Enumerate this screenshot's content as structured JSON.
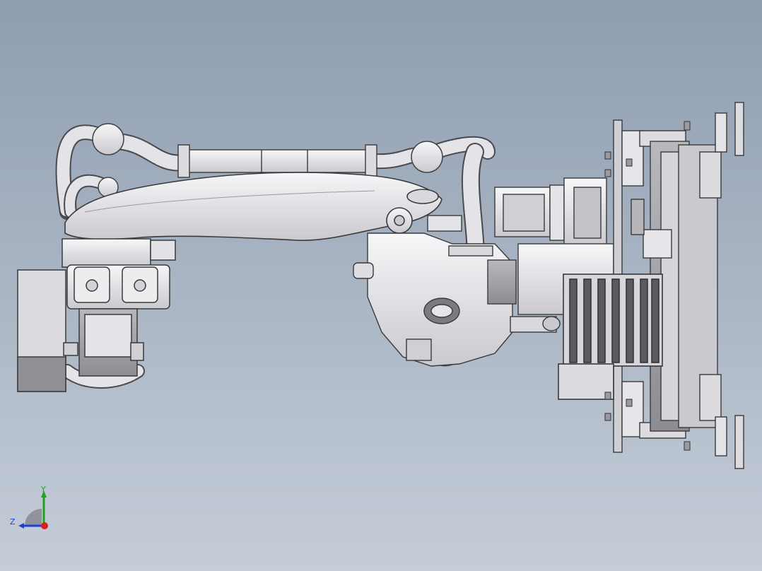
{
  "viewport": {
    "background_top": "#8e9db0",
    "background_bottom": "#c5cdd8"
  },
  "model": {
    "icon": "robot-arm-assembly",
    "body_color": "#e9e9ec",
    "edge_color": "#3a3a3a",
    "shade_color": "#b9b9bf"
  },
  "triad": {
    "y_label": "Y",
    "z_label": "Z",
    "y_color": "#1fa31f",
    "z_color": "#1f3fd6",
    "x_color": "#d61f1f"
  }
}
